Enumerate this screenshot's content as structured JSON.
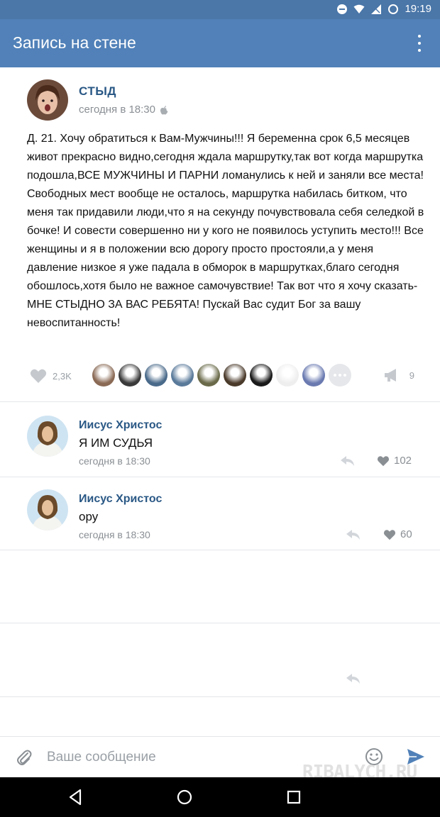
{
  "status_bar": {
    "time": "19:19"
  },
  "toolbar": {
    "title": "Запись на стене"
  },
  "post": {
    "author": "СТЫД",
    "time": "сегодня в 18:30",
    "text": "Д. 21. Хочу обратиться к Вам-Мужчины!!! Я беременна срок 6,5 месяцев живот прекрасно видно,сегодня ждала маршрутку,так вот когда маршрутка подошла,ВСЕ МУЖЧИНЫ И ПАРНИ ломанулись к ней и заняли все места! Свободных мест вообще не осталось, маршрутка набилась битком, что меня так придавили люди,что я на секунду почувствовала себя селедкой в бочке! И совести совершенно ни у кого не появилось уступить место!!! Все женщины и я в положении всю дорогу просто простояли,а у меня давление низкое я уже падала в обморок в маршрутках,благо сегодня обошлось,хотя было не важное самочувствие! Так вот что я хочу сказать- МНЕ СТЫДНО ЗА ВАС РЕБЯТА! Пускай Вас судит Бог за вашу невоспитанность!",
    "likes": "2,3K",
    "shares": "9",
    "liker_colors": [
      "#8a6a55",
      "#3a3a3a",
      "#4a6a8a",
      "#5a7a9a",
      "#6a6a4a",
      "#4a3a2a",
      "#1a1a1a",
      "#eeeeee",
      "#6a7ab0"
    ]
  },
  "comments": [
    {
      "author": "Иисус Христос",
      "text": "Я ИМ СУДЬЯ",
      "time": "сегодня в 18:30",
      "likes": "102"
    },
    {
      "author": "Иисус Христос",
      "text": "ору",
      "time": "сегодня в 18:30",
      "likes": "60"
    }
  ],
  "input": {
    "placeholder": "Ваше сообщение"
  },
  "watermark": "RIBALYCH.RU",
  "colors": {
    "header": "#5181b8",
    "status": "#4a76a8",
    "link": "#2a5885",
    "muted": "#8a8f94"
  }
}
